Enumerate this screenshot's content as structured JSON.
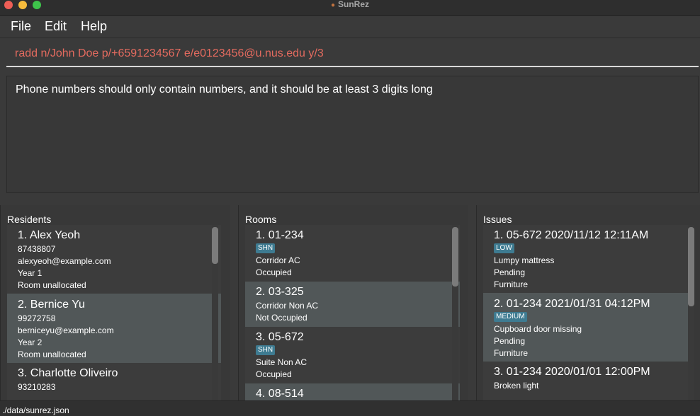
{
  "window": {
    "title": "SunRez",
    "app_icon": "sunrez-app-icon"
  },
  "menu": {
    "file": "File",
    "edit": "Edit",
    "help": "Help"
  },
  "command": {
    "value": "radd n/John Doe p/+6591234567 e/e0123456@u.nus.edu y/3"
  },
  "result": {
    "message": "Phone numbers should only contain numbers, and it should be at least 3 digits long"
  },
  "residents": {
    "title": "Residents",
    "items": [
      {
        "title": "1.  Alex Yeoh",
        "phone": "87438807",
        "email": "alexyeoh@example.com",
        "year": "Year 1",
        "room": "Room unallocated"
      },
      {
        "title": "2.  Bernice Yu",
        "phone": "99272758",
        "email": "berniceyu@example.com",
        "year": "Year 2",
        "room": "Room unallocated"
      },
      {
        "title": "3.  Charlotte Oliveiro",
        "phone": "93210283"
      }
    ]
  },
  "rooms": {
    "title": "Rooms",
    "items": [
      {
        "title": "1.  01-234",
        "tag": "SHN",
        "type": "Corridor AC",
        "status": "Occupied"
      },
      {
        "title": "2.  03-325",
        "type": "Corridor Non AC",
        "status": "Not Occupied"
      },
      {
        "title": "3.  05-672",
        "tag": "SHN",
        "type": "Suite Non AC",
        "status": "Occupied"
      },
      {
        "title": "4.  08-514"
      }
    ]
  },
  "issues": {
    "title": "Issues",
    "items": [
      {
        "title": "1.  05-672  2020/11/12 12:11AM",
        "tag": "LOW",
        "description": "Lumpy mattress",
        "status": "Pending",
        "category": "Furniture"
      },
      {
        "title": "2.  01-234  2021/01/31 04:12PM",
        "tag": "MEDIUM",
        "description": "Cupboard door missing",
        "status": "Pending",
        "category": "Furniture"
      },
      {
        "title": "3.  01-234  2020/01/01 12:00PM",
        "description": "Broken light"
      }
    ]
  },
  "status": {
    "path": "./data/sunrez.json"
  },
  "colors": {
    "command_error": "#e46b5f",
    "tag": "#3e7b91",
    "selected_row": "#515758"
  }
}
